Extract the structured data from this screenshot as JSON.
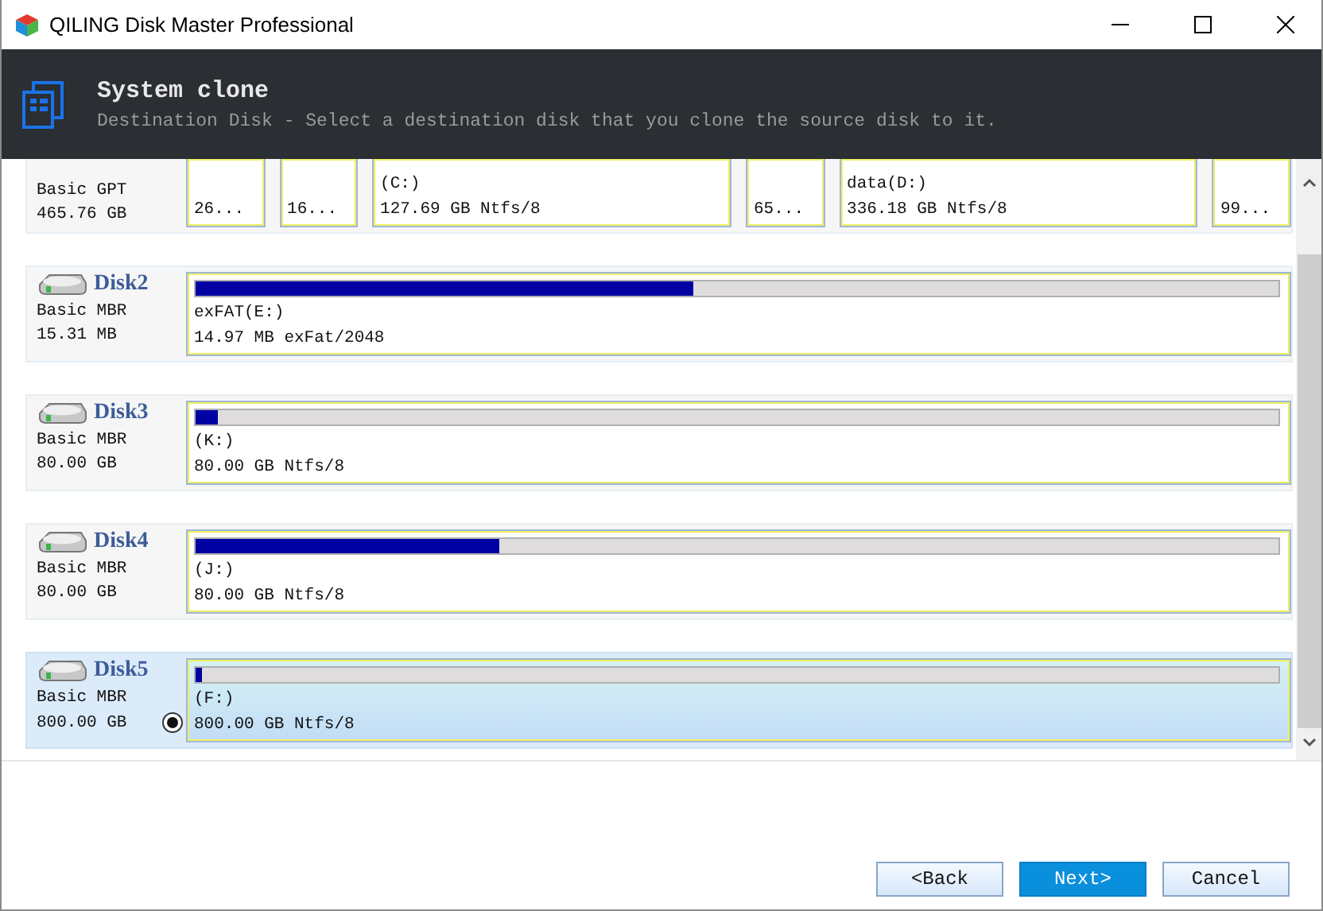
{
  "window": {
    "title": "QILING Disk Master Professional"
  },
  "header": {
    "title": "System clone",
    "subtitle": "Destination Disk - Select a destination disk that you clone the source disk to it."
  },
  "partial_disk": {
    "type": "Basic GPT",
    "size": "465.76 GB",
    "partitions": [
      {
        "detail": "26..."
      },
      {
        "detail": "16..."
      },
      {
        "label": "(C:)",
        "detail": "127.69 GB Ntfs/8"
      },
      {
        "detail": "65..."
      },
      {
        "label": "data(D:)",
        "detail": "336.18 GB Ntfs/8"
      },
      {
        "detail": "99..."
      }
    ]
  },
  "disks": [
    {
      "name": "Disk2",
      "type": "Basic MBR",
      "size": "15.31 MB",
      "selected": false,
      "partition": {
        "label": "exFAT(E:)",
        "detail": "14.97 MB exFat/2048",
        "level": 0.46
      }
    },
    {
      "name": "Disk3",
      "type": "Basic MBR",
      "size": "80.00 GB",
      "selected": false,
      "partition": {
        "label": "(K:)",
        "detail": "80.00 GB Ntfs/8",
        "level": 0.02
      }
    },
    {
      "name": "Disk4",
      "type": "Basic MBR",
      "size": "80.00 GB",
      "selected": false,
      "partition": {
        "label": "(J:)",
        "detail": "80.00 GB Ntfs/8",
        "level": 0.28
      }
    },
    {
      "name": "Disk5",
      "type": "Basic MBR",
      "size": "800.00 GB",
      "selected": true,
      "partition": {
        "label": "(F:)",
        "detail": "800.00 GB Ntfs/8",
        "level": 0.006
      }
    }
  ],
  "buttons": [
    {
      "label": "<Back",
      "kind": "normal"
    },
    {
      "label": "Next>",
      "kind": "primary"
    },
    {
      "label": "Cancel",
      "kind": "normal"
    }
  ]
}
